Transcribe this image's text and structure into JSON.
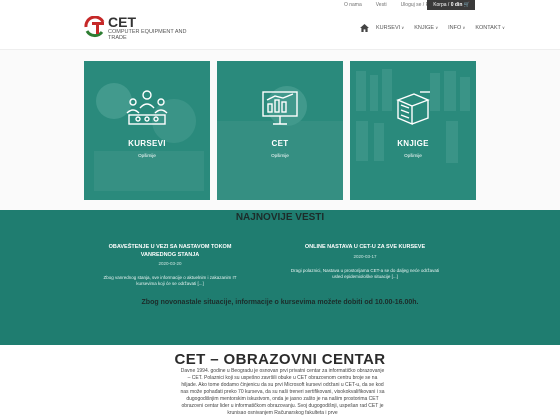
{
  "topbar": {
    "links": [
      "O nama",
      "Vesti",
      "Uloguj se / Registruj se"
    ],
    "cart_label": "Korpa /",
    "cart_value": "0 din"
  },
  "header": {
    "logo_name": "CET",
    "logo_sub": "COMPUTER EQUIPMENT AND TRADE",
    "nav": [
      "KURSEVI",
      "KNJIGE",
      "INFO",
      "KONTAKT"
    ]
  },
  "tiles": [
    {
      "title": "KURSEVI",
      "sub": "Opširnije"
    },
    {
      "title": "CET",
      "sub": "Opširnije"
    },
    {
      "title": "KNJIGE",
      "sub": "Opširnije"
    }
  ],
  "news": {
    "heading": "NAJNOVIJE VESTI",
    "items": [
      {
        "title": "OBAVEŠTENJE U VEZI SA NASTAVOM TOKOM VANREDNOG STANJA",
        "date": "2020-03-20",
        "text": "Zbog vanrednog stanja, sve informacije o aktuelnim i zakazanim IT kursevima koji će se održavati [...]"
      },
      {
        "title": "ONLINE NASTAVA U CET-U ZA SVE KURSEVE",
        "date": "2020-03-17",
        "text": "Dragi polaznici, Nastava u prostorijama CET-a se do daljeg neće održavati usled epidemiološke situacije [...]"
      }
    ],
    "notice": "Zbog novonastale situacije, informacije o kursevima možete dobiti od 10.00-16.00h."
  },
  "about": {
    "heading": "CET – OBRAZOVNI CENTAR",
    "paragraph": "Davne 1994. godine u Beogradu je osnovan prvi privatni centar za informatičko obrazovanje – CET. Polaznici koji su uspešno završili obuke u CET obrazovnom centru broje se na hiljade. Ako tome dodamo činjenicu da su prvi Microsoft kursevi održani u CET-u, da se kod nas može pohađati preko 70 kurseva, da su naši treneri sertifikovani, visokokvalifikovani i sa dugogodišnjim mentorskim iskustvom, onda je jasno zašto je na našim prostorima CET obrazovni centar lider u informatičkom obrazovanju. Svoj dugogodišnji, uspešan rad CET je krunisao osnivanjem Računarskog fakulteta i prve"
  },
  "colors": {
    "accent": "#2a8a7c",
    "news_bg": "#1f7d70"
  }
}
